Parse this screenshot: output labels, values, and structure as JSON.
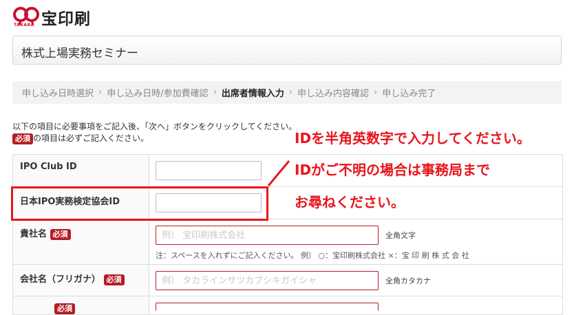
{
  "logo": {
    "brand_text": "宝印刷",
    "sub_text": "TAKARA"
  },
  "page_title": "株式上場実務セミナー",
  "steps": [
    {
      "label": "申し込み日時選択",
      "active": false
    },
    {
      "label": "申し込み日時/参加費確認",
      "active": false
    },
    {
      "label": "出席者情報入力",
      "active": true
    },
    {
      "label": "申し込み内容確認",
      "active": false
    },
    {
      "label": "申し込み完了",
      "active": false
    }
  ],
  "step_separator": "›",
  "intro": {
    "line1": "以下の項目に必要事項をご記入後、「次へ」ボタンをクリックしてください。",
    "required_badge": "必須",
    "line2_suffix": "の項目は必ずご記入ください。"
  },
  "form": {
    "ipo_club_id": {
      "label": "IPO Club ID",
      "value": ""
    },
    "kyokai_id": {
      "label": "日本IPO実務検定協会ID",
      "value": ""
    },
    "company_name": {
      "label": "貴社名",
      "required_badge": "必須",
      "placeholder": "例） 宝印刷株式会社",
      "hint": "全角文字",
      "note": "注：スペースを入れずにご記入ください。 例） ○：宝印刷株式会社 ×：宝 印 刷 株 式 会 社"
    },
    "company_kana": {
      "label": "会社名（フリガナ）",
      "required_badge": "必須",
      "placeholder": "例） タカラインサツカブシキガイシャ",
      "hint": "全角カタカナ"
    }
  },
  "annotation": {
    "line1": "IDを半角英数字で入力してください。",
    "line2": "IDがご不明の場合は事務局まで",
    "line3": "お尋ねください。"
  },
  "colors": {
    "accent_red": "#b51c24",
    "annotation_red": "#e8141c"
  }
}
